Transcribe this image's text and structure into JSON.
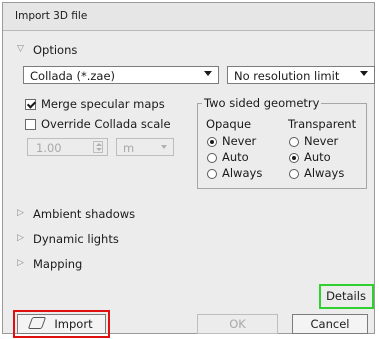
{
  "window": {
    "title": "Import 3D file"
  },
  "options": {
    "header": "Options",
    "format_select": {
      "value": "Collada (*.zae)"
    },
    "resolution_select": {
      "value": "No resolution limit"
    },
    "merge_specular": {
      "label": "Merge specular maps",
      "checked": true
    },
    "override_scale": {
      "label": "Override Collada scale",
      "checked": false
    },
    "scale_value": "1.00",
    "scale_unit": "m",
    "two_sided": {
      "title": "Two sided geometry",
      "opaque": {
        "label": "Opaque",
        "options": [
          "Never",
          "Auto",
          "Always"
        ],
        "selected": "Never"
      },
      "transparent": {
        "label": "Transparent",
        "options": [
          "Never",
          "Auto",
          "Always"
        ],
        "selected": "Auto"
      }
    }
  },
  "sections": {
    "ambient": "Ambient shadows",
    "dynamic": "Dynamic lights",
    "mapping": "Mapping"
  },
  "buttons": {
    "details": "Details",
    "import": "Import",
    "ok": "OK",
    "cancel": "Cancel"
  },
  "colors": {
    "highlight_red": "#e01010",
    "highlight_green": "#30d030"
  }
}
